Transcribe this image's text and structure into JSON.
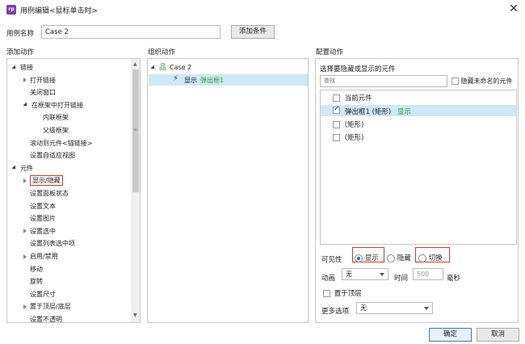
{
  "window": {
    "app_icon_text": "rp",
    "title": "用例编辑<鼠标单击时>"
  },
  "case_name": {
    "label": "用例名称",
    "value": "Case 2",
    "add_condition_label": "添加条件"
  },
  "sections": {
    "add_action": "添加动作",
    "organize_action": "组织动作",
    "configure_action": "配置动作"
  },
  "add_action_tree": [
    {
      "label": "链接",
      "level": 0,
      "expand": "down"
    },
    {
      "label": "打开链接",
      "level": 1,
      "expand": "right"
    },
    {
      "label": "关闭窗口",
      "level": 1,
      "expand": "none"
    },
    {
      "label": "在框架中打开链接",
      "level": 1,
      "expand": "down"
    },
    {
      "label": "内联框架",
      "level": 2,
      "expand": "none"
    },
    {
      "label": "父级框架",
      "level": 2,
      "expand": "none"
    },
    {
      "label": "滚动到元件<锚链接>",
      "level": 1,
      "expand": "none"
    },
    {
      "label": "设置自适应视图",
      "level": 1,
      "expand": "none"
    },
    {
      "label": "元件",
      "level": 0,
      "expand": "down"
    },
    {
      "label": "显示/隐藏",
      "level": 1,
      "expand": "right"
    },
    {
      "label": "设置面板状态",
      "level": 1,
      "expand": "none"
    },
    {
      "label": "设置文本",
      "level": 1,
      "expand": "none"
    },
    {
      "label": "设置图片",
      "level": 1,
      "expand": "none"
    },
    {
      "label": "设置选中",
      "level": 1,
      "expand": "right"
    },
    {
      "label": "设置列表选中项",
      "level": 1,
      "expand": "none"
    },
    {
      "label": "启用/禁用",
      "level": 1,
      "expand": "right"
    },
    {
      "label": "移动",
      "level": 1,
      "expand": "none"
    },
    {
      "label": "旋转",
      "level": 1,
      "expand": "none"
    },
    {
      "label": "设置尺寸",
      "level": 1,
      "expand": "none"
    },
    {
      "label": "置于顶层/底层",
      "level": 1,
      "expand": "right"
    },
    {
      "label": "设置不透明",
      "level": 1,
      "expand": "none"
    }
  ],
  "organize": {
    "case_label": "Case 2",
    "action_prefix": "显示",
    "action_target": "弹出框1"
  },
  "configure": {
    "select_label": "选择要隐藏或显示的元件",
    "search_placeholder": "查找",
    "hide_unnamed_label": "隐藏未命名的元件",
    "widgets": [
      {
        "label": "当前元件",
        "suffix": "",
        "checked": false
      },
      {
        "label": "弹出框1 (矩形)",
        "suffix": "显示",
        "checked": true
      },
      {
        "label": "(矩形)",
        "suffix": "",
        "checked": false
      },
      {
        "label": "(矩形)",
        "suffix": "",
        "checked": false
      }
    ],
    "visibility_label": "可见性",
    "show_label": "显示",
    "hide_label": "隐藏",
    "toggle_label": "切换",
    "animation_label": "动画",
    "animation_value": "无",
    "time_label": "时间",
    "time_value": "500",
    "ms_label": "毫秒",
    "bring_front_label": "置于顶层",
    "more_options_label": "更多选项",
    "more_options_value": "无"
  },
  "footer": {
    "ok_label": "确定",
    "cancel_label": "取消"
  },
  "colors": {
    "accent": "#2a9a2a",
    "selection": "#cfe8f7",
    "highlight_box": "#e0342a",
    "radio_dot": "#1a6fd0"
  }
}
